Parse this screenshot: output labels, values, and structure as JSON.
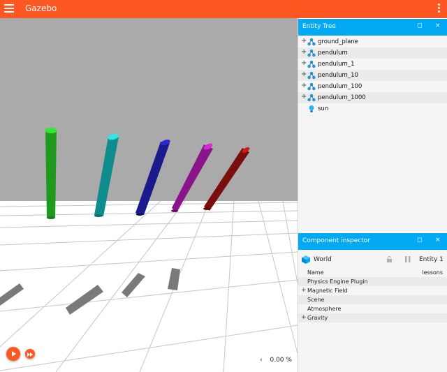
{
  "app": {
    "title": "Gazebo"
  },
  "entity_tree": {
    "title": "Entity Tree",
    "float_icon": "◻",
    "close_icon": "×",
    "items": [
      {
        "label": "ground_plane",
        "icon": "model-icon",
        "expandable": true
      },
      {
        "label": "pendulum",
        "icon": "model-icon",
        "expandable": true
      },
      {
        "label": "pendulum_1",
        "icon": "model-icon",
        "expandable": true
      },
      {
        "label": "pendulum_10",
        "icon": "model-icon",
        "expandable": true
      },
      {
        "label": "pendulum_100",
        "icon": "model-icon",
        "expandable": true
      },
      {
        "label": "pendulum_1000",
        "icon": "model-icon",
        "expandable": true
      },
      {
        "label": "sun",
        "icon": "light-icon",
        "expandable": false
      }
    ]
  },
  "component_inspector": {
    "title": "Component inspector",
    "float_icon": "◻",
    "close_icon": "×",
    "entity_name": "World",
    "entity_label": "Entity 1",
    "rows": [
      {
        "label": "Name",
        "value": "lessons",
        "expandable": false
      },
      {
        "label": "Physics Engine Plugin",
        "value": "",
        "expandable": false
      },
      {
        "label": "Magnetic Field",
        "value": "",
        "expandable": true
      },
      {
        "label": "Scene",
        "value": "",
        "expandable": false
      },
      {
        "label": "Atmosphere",
        "value": "",
        "expandable": false
      },
      {
        "label": "Gravity",
        "value": "",
        "expandable": true
      }
    ]
  },
  "viewport": {
    "rtf_chevron": "‹",
    "rtf": "0.00 %",
    "pendulum_colors": [
      "#1f9a1f",
      "#0f8c8c",
      "#1a1a8c",
      "#8a158a",
      "#7a0d0d"
    ],
    "pendulum_cap_colors": [
      "#33e633",
      "#33e6e6",
      "#2a2ad0",
      "#d42ad4",
      "#d01a1a"
    ]
  },
  "colors": {
    "app_bar": "#ff5722",
    "panel_header": "#03a9f4",
    "sky": "#aaaaaa",
    "ground": "#ffffff"
  }
}
